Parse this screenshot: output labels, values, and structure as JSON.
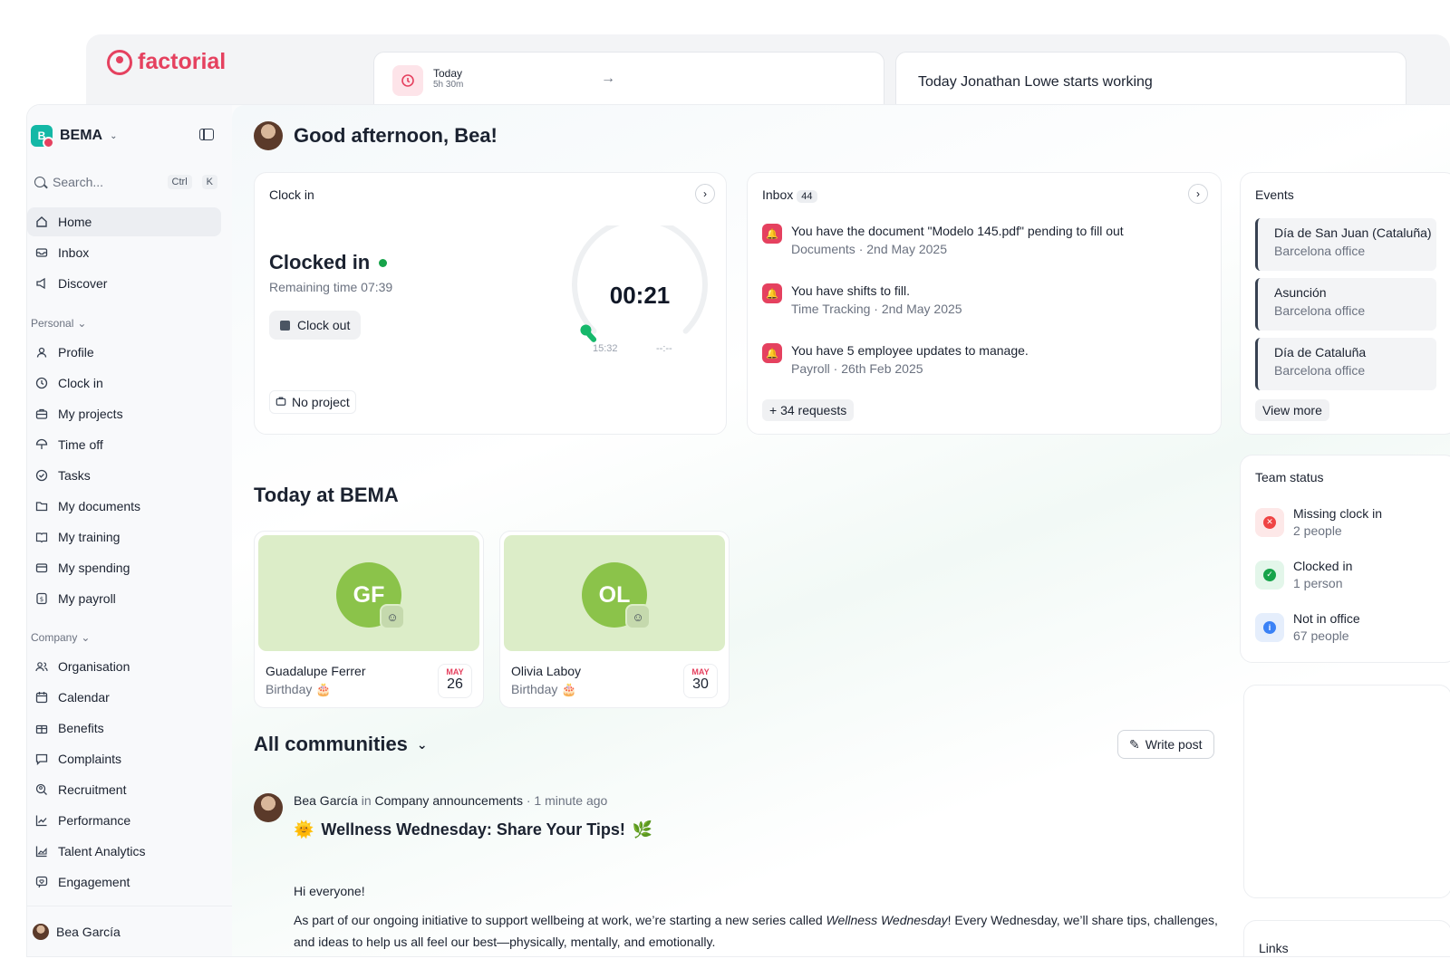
{
  "background_window": {
    "brand": "factorial",
    "today_card": {
      "label": "Today",
      "duration": "5h 30m"
    },
    "notice": "Today Jonathan Lowe starts working"
  },
  "sidebar": {
    "company": "BEMA",
    "company_initial": "B",
    "search": {
      "placeholder": "Search...",
      "shortcut_1": "Ctrl",
      "shortcut_2": "K"
    },
    "main_items": [
      {
        "label": "Home",
        "icon": "home-icon",
        "active": true
      },
      {
        "label": "Inbox",
        "icon": "inbox-icon"
      },
      {
        "label": "Discover",
        "icon": "megaphone-icon"
      }
    ],
    "personal_label": "Personal",
    "personal_items": [
      {
        "label": "Profile",
        "icon": "user-icon"
      },
      {
        "label": "Clock in",
        "icon": "clock-icon"
      },
      {
        "label": "My projects",
        "icon": "briefcase-icon"
      },
      {
        "label": "Time off",
        "icon": "umbrella-icon"
      },
      {
        "label": "Tasks",
        "icon": "check-circle-icon"
      },
      {
        "label": "My documents",
        "icon": "folder-icon"
      },
      {
        "label": "My training",
        "icon": "book-icon"
      },
      {
        "label": "My spending",
        "icon": "wallet-icon"
      },
      {
        "label": "My payroll",
        "icon": "dollar-icon"
      }
    ],
    "company_label": "Company",
    "company_items": [
      {
        "label": "Organisation",
        "icon": "people-icon"
      },
      {
        "label": "Calendar",
        "icon": "calendar-icon"
      },
      {
        "label": "Benefits",
        "icon": "gift-icon"
      },
      {
        "label": "Complaints",
        "icon": "chat-icon"
      },
      {
        "label": "Recruitment",
        "icon": "search-person-icon"
      },
      {
        "label": "Performance",
        "icon": "trend-icon"
      },
      {
        "label": "Talent Analytics",
        "icon": "chart-icon"
      },
      {
        "label": "Engagement",
        "icon": "heart-chat-icon"
      }
    ],
    "user": "Bea García"
  },
  "main": {
    "greeting": "Good afternoon, Bea!",
    "clock_card": {
      "title": "Clock in",
      "status": "Clocked in",
      "remaining": "Remaining time 07:39",
      "clock_out": "Clock out",
      "project": "No project",
      "timer": "00:21",
      "start": "15:32",
      "end": "--:--",
      "elapsed_fraction": 0.04
    },
    "inbox_card": {
      "title": "Inbox",
      "count": "44",
      "items": [
        {
          "text": "You have the document \"Modelo 145.pdf\" pending to fill out",
          "sub": "Documents · 2nd May 2025"
        },
        {
          "text": "You have shifts to fill.",
          "sub": "Time Tracking · 2nd May 2025"
        },
        {
          "text": "You have 5 employee updates to manage.",
          "sub": "Payroll · 26th Feb 2025"
        }
      ],
      "more": "+ 34 requests"
    },
    "events_card": {
      "title": "Events",
      "items": [
        {
          "name": "Día de San Juan (Cataluña)",
          "office": "Barcelona office"
        },
        {
          "name": "Asunción",
          "office": "Barcelona office"
        },
        {
          "name": "Día de Cataluña",
          "office": "Barcelona office"
        }
      ],
      "view_more": "View more"
    },
    "team_status": {
      "title": "Team status",
      "items": [
        {
          "label": "Missing clock in",
          "count": "2 people",
          "color": "#ef4444",
          "bg": "#fde8e8",
          "glyph": "✕"
        },
        {
          "label": "Clocked in",
          "count": "1 person",
          "color": "#16a34a",
          "bg": "#e3f6ea",
          "glyph": "✓"
        },
        {
          "label": "Not in office",
          "count": "67 people",
          "color": "#3b82f6",
          "bg": "#e5eefc",
          "glyph": "i"
        }
      ]
    },
    "today_title": "Today at BEMA",
    "birthdays": [
      {
        "initials": "GF",
        "name": "Guadalupe Ferrer",
        "label": "Birthday",
        "month": "MAY",
        "day": "26"
      },
      {
        "initials": "OL",
        "name": "Olivia Laboy",
        "label": "Birthday",
        "month": "MAY",
        "day": "30"
      }
    ],
    "communities_title": "All communities",
    "write_post": "Write post",
    "post": {
      "author": "Bea García",
      "in": "in",
      "community": "Company announcements",
      "time": "· 1 minute ago",
      "title": "Wellness Wednesday: Share Your Tips!",
      "p1": "Hi everyone!",
      "p2a": "As part of our ongoing initiative to support wellbeing at work, we’re starting a new series called ",
      "p2em": "Wellness Wednesday",
      "p2b": "! Every Wednesday, we’ll share tips, challenges, and ideas to help us all feel our best—physically, mentally, and emotionally."
    },
    "links_title": "Links"
  }
}
